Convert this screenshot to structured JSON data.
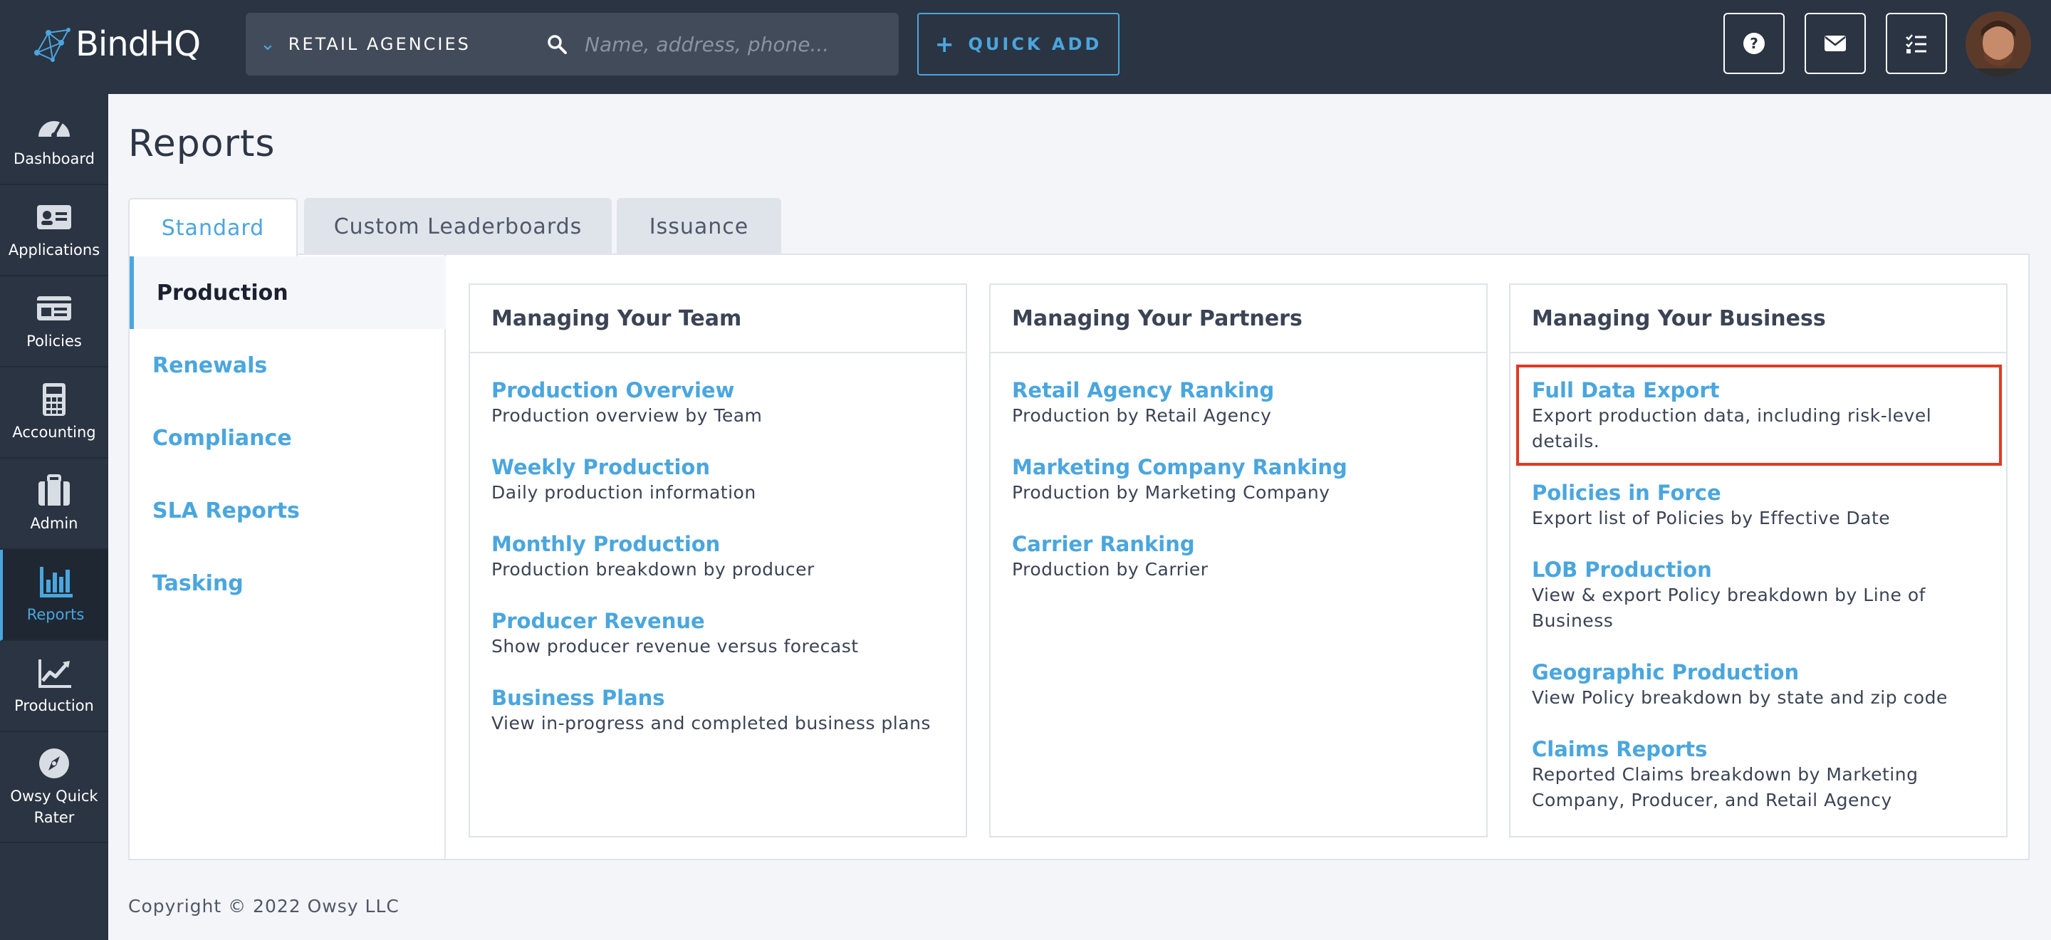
{
  "app": {
    "logo_text": "BindHQ",
    "agency_selector": "RETAIL AGENCIES",
    "search_placeholder": "Name, address, phone...",
    "quick_add_label": "QUICK ADD"
  },
  "sidebar": {
    "items": [
      {
        "label": "Dashboard",
        "icon": "gauge-icon"
      },
      {
        "label": "Applications",
        "icon": "id-card-icon"
      },
      {
        "label": "Policies",
        "icon": "policy-card-icon"
      },
      {
        "label": "Accounting",
        "icon": "calculator-icon"
      },
      {
        "label": "Admin",
        "icon": "briefcase-icon"
      },
      {
        "label": "Reports",
        "icon": "bar-chart-icon",
        "active": true
      },
      {
        "label": "Production",
        "icon": "line-chart-icon"
      },
      {
        "label": "Owsy Quick Rater",
        "icon": "compass-icon"
      }
    ]
  },
  "page": {
    "title": "Reports",
    "tabs": [
      "Standard",
      "Custom Leaderboards",
      "Issuance"
    ],
    "active_tab": "Standard"
  },
  "subnav": {
    "items": [
      "Production",
      "Renewals",
      "Compliance",
      "SLA Reports",
      "Tasking"
    ],
    "active": "Production"
  },
  "cards": [
    {
      "title": "Managing Your Team",
      "reports": [
        {
          "name": "Production Overview",
          "desc": "Production overview by Team"
        },
        {
          "name": "Weekly Production",
          "desc": "Daily production information"
        },
        {
          "name": "Monthly Production",
          "desc": "Production breakdown by producer"
        },
        {
          "name": "Producer Revenue",
          "desc": "Show producer revenue versus forecast"
        },
        {
          "name": "Business Plans",
          "desc": "View in-progress and completed business plans"
        }
      ]
    },
    {
      "title": "Managing Your Partners",
      "reports": [
        {
          "name": "Retail Agency Ranking",
          "desc": "Production by Retail Agency"
        },
        {
          "name": "Marketing Company Ranking",
          "desc": "Production by Marketing Company"
        },
        {
          "name": "Carrier Ranking",
          "desc": "Production by Carrier"
        }
      ]
    },
    {
      "title": "Managing Your Business",
      "reports": [
        {
          "name": "Full Data Export",
          "desc": "Export production data, including risk-level details."
        },
        {
          "name": "Policies in Force",
          "desc": "Export list of Policies by Effective Date"
        },
        {
          "name": "LOB Production",
          "desc": "View & export Policy breakdown by Line of Business"
        },
        {
          "name": "Geographic Production",
          "desc": "View Policy breakdown by state and zip code"
        },
        {
          "name": "Claims Reports",
          "desc": "Reported Claims breakdown by Marketing Company, Producer, and Retail Agency"
        }
      ]
    }
  ],
  "footer": {
    "copyright": "Copyright © 2022 Owsy LLC"
  },
  "colors": {
    "accent": "#4aa6de",
    "topbar": "#2b3442",
    "highlight": "#e03a24"
  }
}
